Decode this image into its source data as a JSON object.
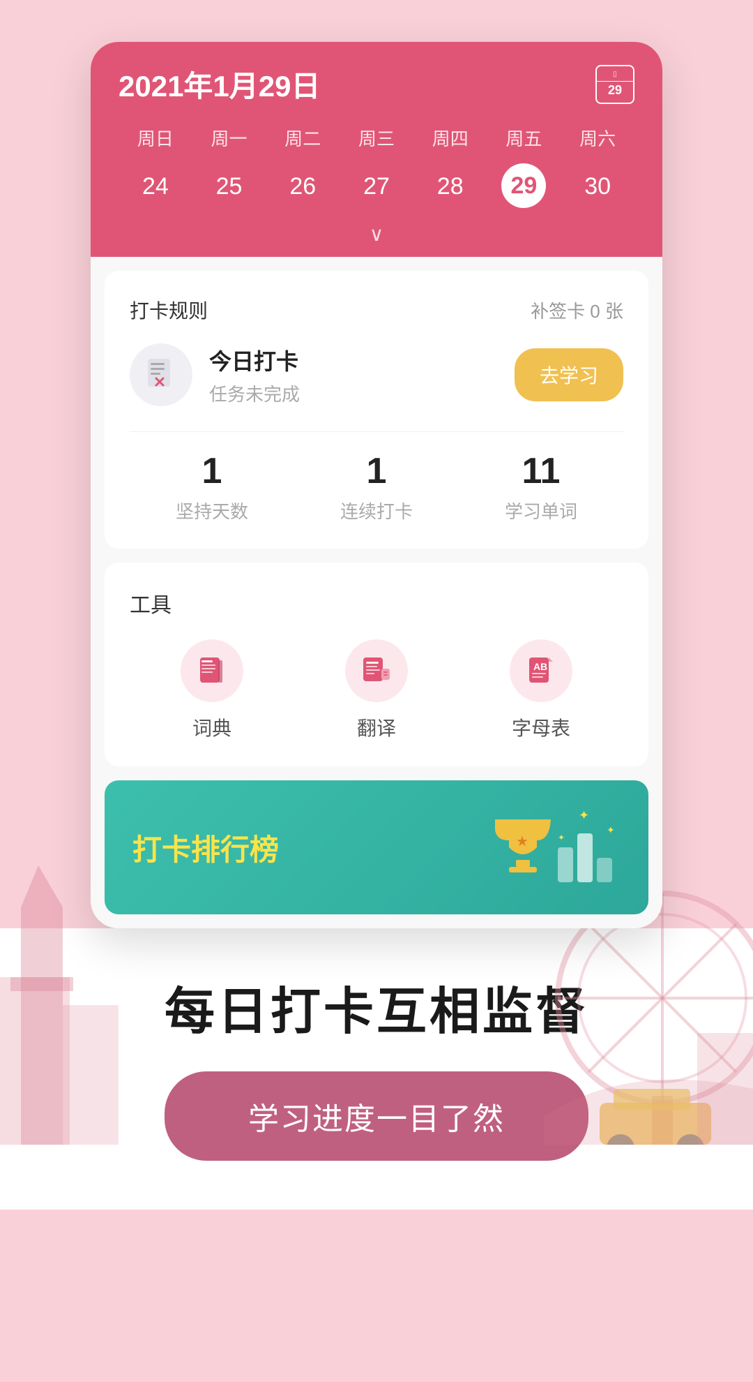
{
  "app": {
    "background_color": "#f9d0d8"
  },
  "calendar": {
    "title": "2021年1月29日",
    "icon_number": "29",
    "weekdays": [
      "周日",
      "周一",
      "周二",
      "周三",
      "周四",
      "周五",
      "周六"
    ],
    "dates": [
      "24",
      "25",
      "26",
      "27",
      "28",
      "29",
      "30"
    ],
    "active_date": "29"
  },
  "checkin_card": {
    "rules_label": "打卡规则",
    "supplement_label": "补签卡 0 张",
    "checkin_title": "今日打卡",
    "checkin_subtitle": "任务未完成",
    "go_study_btn": "去学习",
    "stats": [
      {
        "number": "1",
        "label": "坚持天数"
      },
      {
        "number": "1",
        "label": "连续打卡"
      },
      {
        "number": "11",
        "label": "学习单词"
      }
    ]
  },
  "tools_card": {
    "title": "工具",
    "items": [
      {
        "label": "词典",
        "icon": "dictionary"
      },
      {
        "label": "翻译",
        "icon": "translate"
      },
      {
        "label": "字母表",
        "icon": "alphabet"
      }
    ]
  },
  "ranking_banner": {
    "text_prefix": "打卡",
    "text_highlight": "排行榜"
  },
  "bottom": {
    "title": "每日打卡互相监督",
    "button_label": "学习进度一目了然"
  }
}
